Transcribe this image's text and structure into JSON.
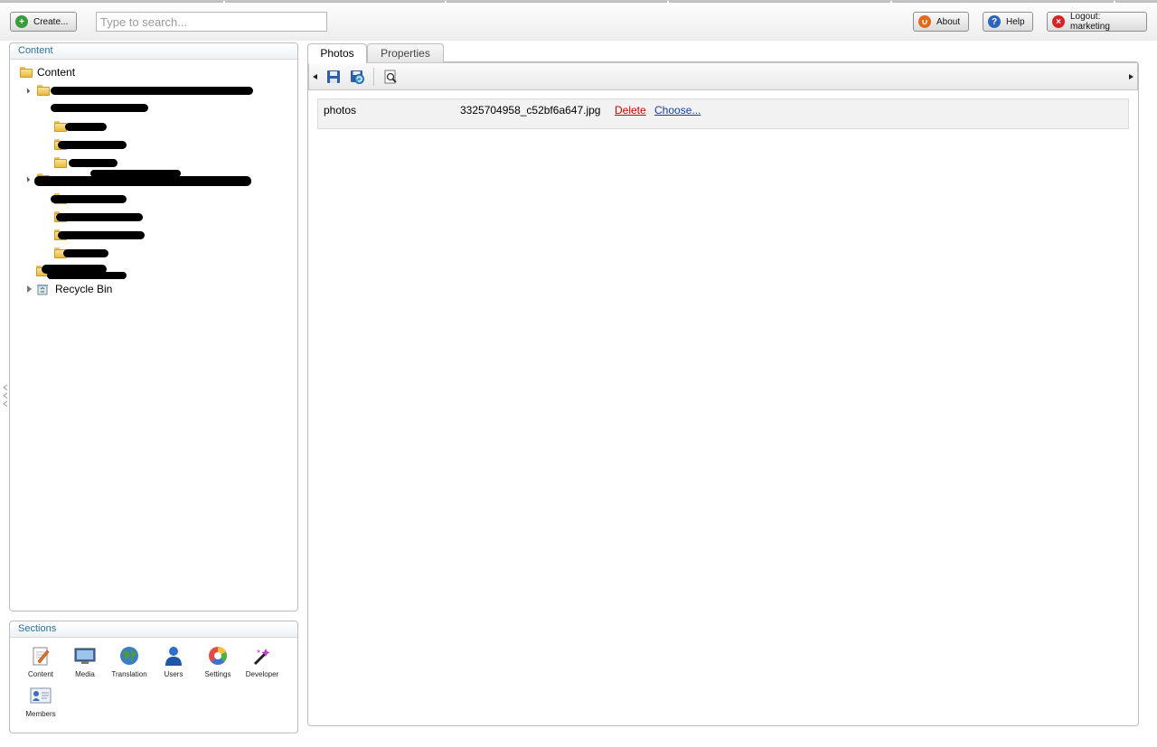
{
  "header": {
    "create_label": "Create...",
    "search_placeholder": "Type to search...",
    "about_label": "About",
    "help_label": "Help",
    "logout_label": "Logout: marketing"
  },
  "content_panel": {
    "title": "Content",
    "root_label": "Content",
    "recycle_label": "Recycle Bin"
  },
  "sections": {
    "title": "Sections",
    "items": [
      {
        "label": "Content",
        "icon": "content-pencil-icon"
      },
      {
        "label": "Media",
        "icon": "media-monitor-icon"
      },
      {
        "label": "Translation",
        "icon": "translation-globe-icon"
      },
      {
        "label": "Users",
        "icon": "users-person-icon"
      },
      {
        "label": "Settings",
        "icon": "settings-color-wheel-icon"
      },
      {
        "label": "Developer",
        "icon": "developer-wand-icon"
      },
      {
        "label": "Members",
        "icon": "members-card-icon"
      }
    ]
  },
  "editor": {
    "tabs": [
      {
        "label": "Photos",
        "active": true
      },
      {
        "label": "Properties",
        "active": false
      }
    ],
    "property": {
      "label": "photos",
      "file_name": "3325704958_c52bf6a647.jpg",
      "delete_label": "Delete",
      "choose_label": "Choose..."
    }
  },
  "colors": {
    "panel_title": "#2b6f9e",
    "delete_link": "#cc0000",
    "choose_link": "#1a3d9c"
  }
}
